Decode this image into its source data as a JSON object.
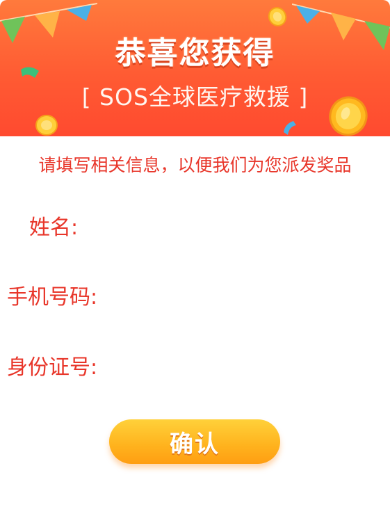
{
  "header": {
    "title": "恭喜您获得",
    "subtitle": "[ SOS全球医疗救援 ]"
  },
  "notice": "请填写相关信息，以便我们为您派发奖品",
  "form": {
    "name_label": "姓名:",
    "phone_label": "手机号码:",
    "id_label": "身份证号:",
    "name_value": "",
    "phone_value": "",
    "id_value": ""
  },
  "confirm_label": "确认",
  "colors": {
    "header_orange": "#ff5b33",
    "label_red": "#e8362a",
    "button_yellow": "#ffb21d"
  }
}
